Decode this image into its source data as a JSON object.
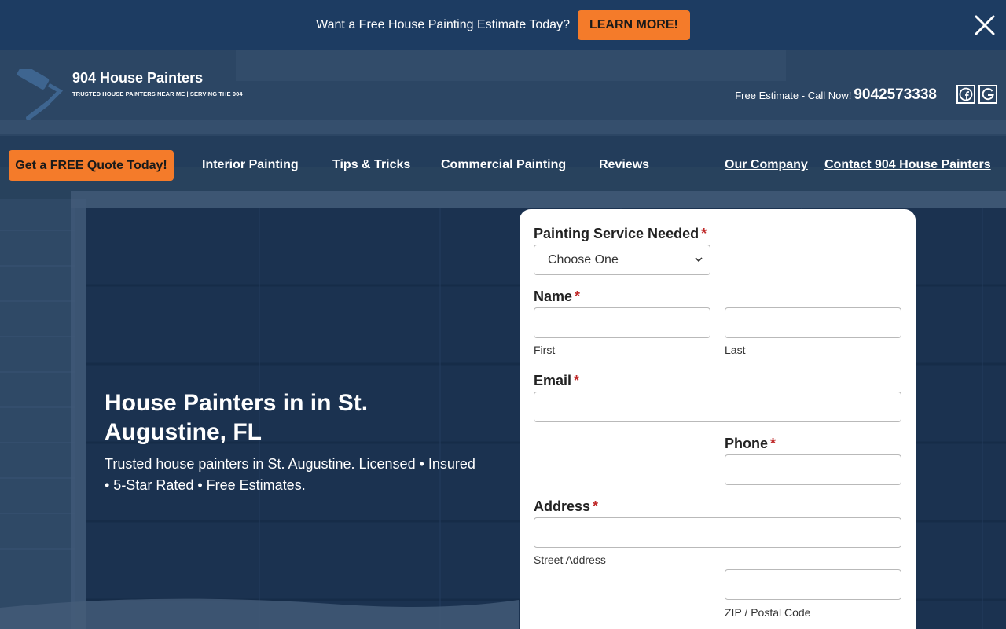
{
  "announcement": {
    "text": "Want a Free House Painting Estimate Today?",
    "button_label": "LEARN MORE!"
  },
  "header": {
    "brand_name": "904 House Painters",
    "brand_tagline": "TRUSTED HOUSE PAINTERS NEAR ME | SERVING THE 904",
    "call_prefix": "Free Estimate - Call Now!",
    "phone": "9042573338",
    "social": [
      "facebook-icon",
      "google-icon"
    ]
  },
  "nav": {
    "quote_button": "Get a FREE Quote Today!",
    "items": [
      "Interior Painting",
      "Tips & Tricks",
      "Commercial Painting",
      "Reviews"
    ],
    "right_links": [
      "Our Company",
      "Contact 904 House Painters"
    ]
  },
  "hero": {
    "title": "House Painters in in St. Augustine, FL",
    "subtitle": "Trusted house painters in St. Augustine. Licensed • Insured • 5-Star Rated • Free Estimates."
  },
  "form": {
    "service_label": "Painting Service Needed",
    "service_selected": "Choose One",
    "name_label": "Name",
    "first_label": "First",
    "last_label": "Last",
    "email_label": "Email",
    "phone_label": "Phone",
    "address_label": "Address",
    "street_label": "Street Address",
    "zip_label": "ZIP / Postal Code",
    "required_mark": "*"
  },
  "colors": {
    "accent": "#f47b2a",
    "topbar": "#1d3c62",
    "required": "#c02b2b"
  }
}
